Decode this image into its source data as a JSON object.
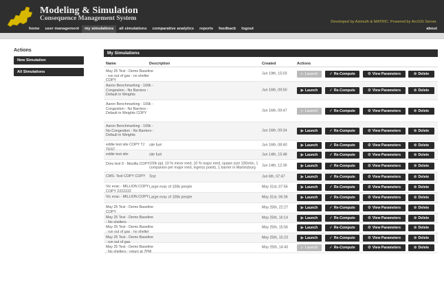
{
  "header": {
    "title": "Modeling & Simulation",
    "subtitle": "Consequence Management System",
    "credits": "Developed by Azimuth & MATRIC. Powered by ArcGIS Server.",
    "nav": [
      "home",
      "user management",
      "my simulations",
      "all simulations",
      "comparative analytics",
      "reports",
      "feedback",
      "logout"
    ],
    "nav_active": "my simulations",
    "about": "about"
  },
  "sidebar": {
    "title": "Actions",
    "buttons": [
      "New Simulation",
      "All Simulations"
    ]
  },
  "panel": {
    "title": "My Simulations",
    "columns": {
      "name": "Name",
      "description": "Description",
      "created": "Created",
      "actions": "Actions"
    },
    "actions": {
      "launch": "Launch",
      "recompute": "Re-Compute",
      "params": "View Parameters",
      "delete": "Delete"
    },
    "rows": [
      {
        "name": "May 25 Test - Demo Baseline : run out of gas : no shelter COPY",
        "description": "",
        "created": "Jun 19th, 15:03",
        "launch_enabled": false
      },
      {
        "name": "Aaron Benchmarking - 100k - Congestion - No Barriers - Default in Weights",
        "description": "",
        "created": "Jun 16th, 09:50",
        "launch_enabled": true
      },
      {
        "name": "Aaron Benchmarking - 100k - Congestion - No Barriers - Default in Weights COPY",
        "description": "",
        "created": "Jun 16th, 09:47",
        "launch_enabled": false
      },
      {
        "name": "Aaron Benchmarking - 100k - No Congestion - No Barriers - Default in Weights",
        "description": "",
        "created": "Jun 16th, 09:34",
        "launch_enabled": true
      },
      {
        "name": "eddie test site COPY TJ TEST",
        "description": "site fuel",
        "created": "Jun 16th, 08:40",
        "launch_enabled": true
      },
      {
        "name": "eddie test site",
        "description": "site fuel",
        "created": "Jun 14th, 15:48",
        "launch_enabled": true
      },
      {
        "name": "Doru test 9 - Mozilla COPY",
        "description": "100k ppl, 10 % minor med, 10 % major med, spawn size 100/min, 1 companion per major med, ingress points, 1 barrier in Martinsburg",
        "created": "Jun 14th, 12:36",
        "launch_enabled": true
      },
      {
        "name": "CMS- Test COPY COPY",
        "description": "Test",
        "created": "Jun 6th, 07:47",
        "launch_enabled": true
      },
      {
        "name": "Vic evac - MILLION COPY COPY 2222222",
        "description": "Large evac of 100k people",
        "created": "May 31st, 07:56",
        "launch_enabled": true
      },
      {
        "name": "Vic evac - MILLION COPY",
        "description": "Large evac of 100k people",
        "created": "May 31st, 06:36",
        "launch_enabled": true
      },
      {
        "name": "May 25 Test - Demo Baseline COPY",
        "description": "",
        "created": "May 25th, 22:27",
        "launch_enabled": true
      },
      {
        "name": "May 25 Test - Demo Baseline : No shelters",
        "description": "",
        "created": "May 25th, 16:14",
        "launch_enabled": true
      },
      {
        "name": "May 25 Test - Demo Baseline : run out of gas : no shelter",
        "description": "",
        "created": "May 25th, 15:56",
        "launch_enabled": true
      },
      {
        "name": "May 25 Test - Demo Baseline : run out of gas",
        "description": "",
        "created": "May 25th, 15:23",
        "launch_enabled": true
      },
      {
        "name": "May 25 Test - Demo Baseline : No shelters : return at 7PM",
        "description": "",
        "created": "May 25th, 14:43",
        "launch_enabled": false
      }
    ]
  },
  "colors": {
    "header_bg": "#2f2f2f",
    "button_bg": "#2a2a2a",
    "credits": "#c4b84c",
    "disabled": "#b9b9b9"
  }
}
